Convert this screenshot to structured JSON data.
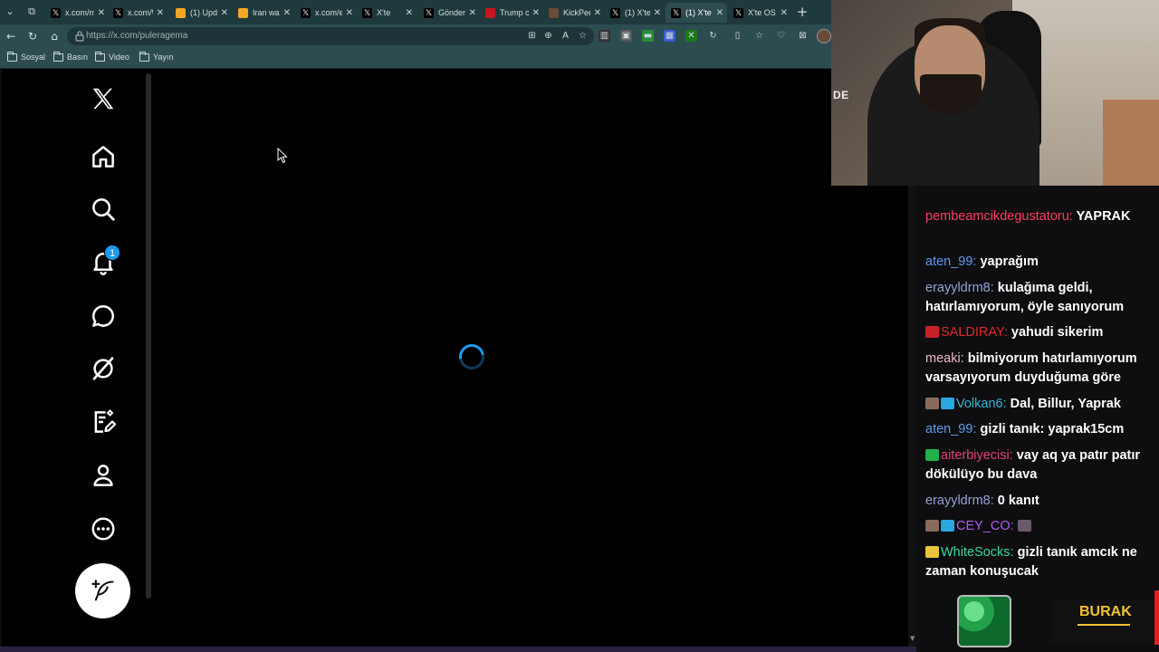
{
  "browser": {
    "tabs": [
      {
        "title": "x.com/m",
        "favicon": "x-icon",
        "fav_color": "#000000"
      },
      {
        "title": "x.com/W",
        "favicon": "x-icon",
        "fav_color": "#000000"
      },
      {
        "title": "(1) Upda",
        "favicon": "orange-icon",
        "fav_color": "#f5a623"
      },
      {
        "title": "Iran war",
        "favicon": "orange-icon",
        "fav_color": "#f5a623"
      },
      {
        "title": "x.com/et",
        "favicon": "x-icon",
        "fav_color": "#000000"
      },
      {
        "title": "X'te",
        "favicon": "x-icon",
        "fav_color": "#000000"
      },
      {
        "title": "Gönderi",
        "favicon": "x-icon",
        "fav_color": "#000000"
      },
      {
        "title": "Trump c",
        "favicon": "news-icon",
        "fav_color": "#c4161c"
      },
      {
        "title": "KickPee",
        "favicon": "avatar-icon",
        "fav_color": "#6b4a3a"
      },
      {
        "title": "(1) X'te",
        "favicon": "x-icon",
        "fav_color": "#000000"
      },
      {
        "title": "(1) X'te",
        "favicon": "x-icon",
        "fav_color": "#000000",
        "active": true
      },
      {
        "title": "X'te OS",
        "favicon": "x-icon",
        "fav_color": "#000000"
      }
    ],
    "close_glyph": "✕",
    "newtab_glyph": "+",
    "url": "https://x.com/puleragema"
  },
  "bookmarks": [
    {
      "label": "Sosyal"
    },
    {
      "label": "Basın"
    },
    {
      "label": "Video"
    },
    {
      "label": "Yayın"
    }
  ],
  "x_app": {
    "notification_count": "1",
    "accent": "#1d9bf0"
  },
  "chat": {
    "messages": [
      {
        "user": "pembeamcikdegustatoru:",
        "text": " YAPRAK",
        "color": "#ff3b5c",
        "badge": null
      },
      {
        "user": "aten_99:",
        "text": " yaprağım",
        "color": "#5b9bf0",
        "badge": null
      },
      {
        "user": "erayyldrm8:",
        "text": " kulağıma geldi, hatırlamıyorum, öyle sanıyorum",
        "color": "#8fa3d6",
        "badge": null
      },
      {
        "user": "SALDIRAY:",
        "text": " yahudi sikerim",
        "color": "#e02a2a",
        "badge": "red"
      },
      {
        "user": "meaki:",
        "text": " bilmiyorum hatırlamıyorum varsayıyorum duyduğuma göre",
        "color": "#f2b8c8",
        "badge": null
      },
      {
        "user": "Volkan6:",
        "text": " Dal, Billur, Yaprak",
        "color": "#35b6d6",
        "badge": "double"
      },
      {
        "user": "aten_99:",
        "text": " gizli tanık: yaprak15cm",
        "color": "#5b9bf0",
        "badge": null
      },
      {
        "user": "aiterbiyecisi:",
        "text": " vay aq ya patır patır dökülüyo bu dava",
        "color": "#e0407a",
        "badge": "green"
      },
      {
        "user": "erayyldrm8:",
        "text": " 0 kanıt",
        "color": "#8fa3d6",
        "badge": null
      },
      {
        "user": "CEY_CO:",
        "text": "",
        "color": "#b05cf0",
        "badge": "double"
      },
      {
        "user": "WhiteSocks:",
        "text": " gizli tanık amcık ne zaman konuşucak",
        "color": "#3ad6a0",
        "badge": "yellow"
      }
    ]
  },
  "overlay": {
    "brand_text": "BURAK",
    "webcam_logo": "DE"
  }
}
